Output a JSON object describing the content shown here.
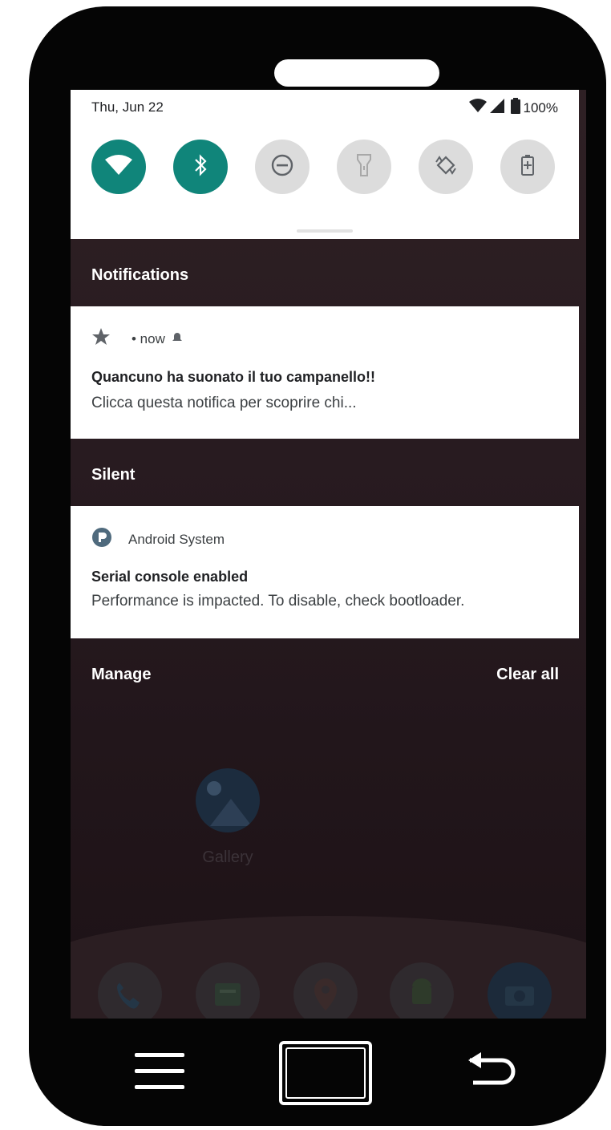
{
  "status_bar": {
    "date": "Thu, Jun 22",
    "battery": "100%"
  },
  "quick_settings": {
    "tiles": [
      {
        "id": "wifi",
        "icon": "wifi-icon",
        "state": "on"
      },
      {
        "id": "bluetooth",
        "icon": "bluetooth-icon",
        "state": "on"
      },
      {
        "id": "do-not-disturb",
        "icon": "do-not-disturb-icon",
        "state": "off"
      },
      {
        "id": "flashlight",
        "icon": "flashlight-icon",
        "state": "off"
      },
      {
        "id": "auto-rotate",
        "icon": "auto-rotate-icon",
        "state": "off"
      },
      {
        "id": "battery-saver",
        "icon": "battery-saver-icon",
        "state": "off"
      }
    ],
    "accent_color": "#10857a"
  },
  "notifications": {
    "section_title": "Notifications",
    "items": [
      {
        "app_icon": "star-icon",
        "time": "• now",
        "title": "Quancuno ha suonato il tuo campanello!!",
        "body": " Clicca questa notifica per scoprire chi..."
      }
    ]
  },
  "silent": {
    "section_title": "Silent",
    "items": [
      {
        "app_icon": "android-system-icon",
        "app_name": "Android System",
        "title": "Serial console enabled",
        "body": "Performance is impacted. To disable, check bootloader."
      }
    ]
  },
  "footer": {
    "manage_label": "Manage",
    "clear_all_label": "Clear all"
  },
  "home": {
    "gallery_label": "Gallery",
    "dock": [
      "phone-icon",
      "messages-icon",
      "maps-icon",
      "android-icon",
      "camera-icon"
    ]
  },
  "nav": {
    "menu_icon": "menu-icon",
    "home_icon": "home-button-icon",
    "back_icon": "back-icon"
  }
}
